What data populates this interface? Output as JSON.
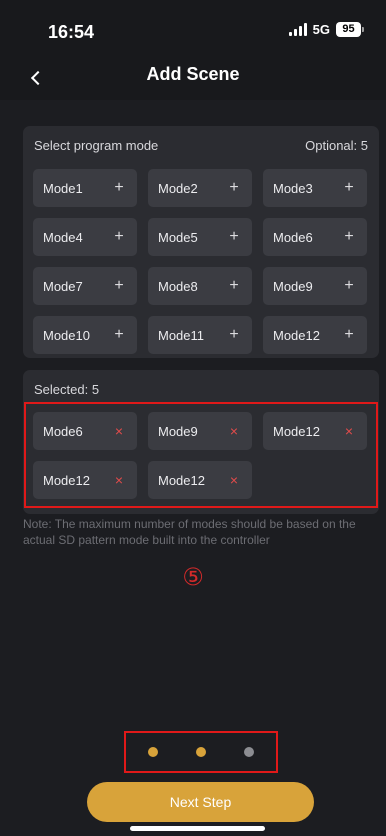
{
  "status_bar": {
    "time": "16:54",
    "network": "5G",
    "battery": "95"
  },
  "header": {
    "title": "Add Scene",
    "back_icon": "chevron-left-icon"
  },
  "program_mode": {
    "label": "Select program mode",
    "optional": "Optional: 5",
    "add_symbol": "+",
    "modes": [
      "Mode1",
      "Mode2",
      "Mode3",
      "Mode4",
      "Mode5",
      "Mode6",
      "Mode7",
      "Mode8",
      "Mode9",
      "Mode10",
      "Mode11",
      "Mode12"
    ]
  },
  "selected": {
    "label": "Selected: 5",
    "remove_symbol": "×",
    "modes": [
      "Mode6",
      "Mode9",
      "Mode12",
      "Mode12",
      "Mode12"
    ]
  },
  "note": "Note: The maximum number of modes should be based on the actual SD pattern mode built into the controller",
  "step_marker": "⑤",
  "pagination": {
    "total": 3,
    "current": 2
  },
  "next_button": {
    "label": "Next Step"
  },
  "colors": {
    "accent": "#d8a33a",
    "remove": "#e34b4b",
    "highlight": "#e01919"
  }
}
